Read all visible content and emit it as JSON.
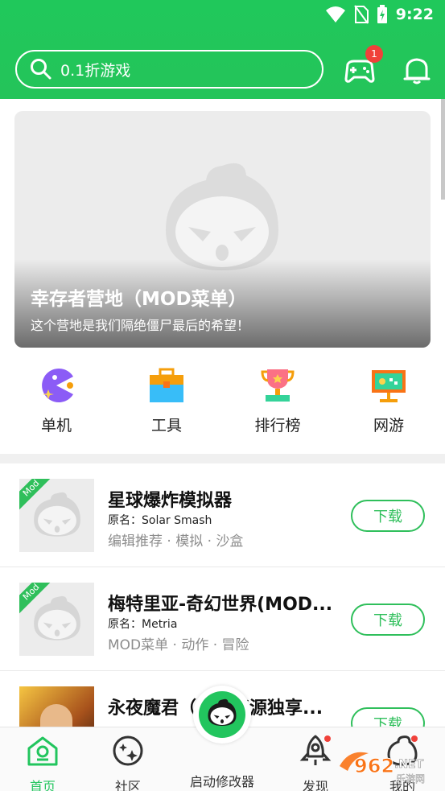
{
  "status_bar": {
    "time": "9:22"
  },
  "header": {
    "search_placeholder": "0.1折游戏",
    "gamepad_badge": "1"
  },
  "banner": {
    "title": "幸存者营地（MOD菜单）",
    "subtitle": "这个营地是我们隔绝僵尸最后的希望！"
  },
  "categories": [
    {
      "label": "单机",
      "icon": "pacman-icon"
    },
    {
      "label": "工具",
      "icon": "toolbox-icon"
    },
    {
      "label": "排行榜",
      "icon": "trophy-icon"
    },
    {
      "label": "网游",
      "icon": "monitor-game-icon"
    }
  ],
  "games": [
    {
      "name": "星球爆炸模拟器",
      "original": "原名：Solar Smash",
      "tags": "编辑推荐 · 模拟 · 沙盒",
      "mod": "Mod",
      "download": "下载"
    },
    {
      "name": "梅特里亚-奇幻世界(MOD...",
      "original": "原名：Metria",
      "tags": "MOD菜单 · 动作 · 冒险",
      "mod": "Mod",
      "download": "下载"
    },
    {
      "name": "永夜魔君（鬼服资源独享...",
      "original": "",
      "tags": "",
      "mod": "",
      "download": "下载"
    }
  ],
  "bottom_nav": [
    {
      "label": "首页",
      "icon": "home-icon",
      "active": true
    },
    {
      "label": "社区",
      "icon": "community-icon",
      "active": false
    },
    {
      "label": "启动修改器",
      "icon": "launcher-icon",
      "active": false
    },
    {
      "label": "发现",
      "icon": "rocket-icon",
      "active": false
    },
    {
      "label": "我的",
      "icon": "profile-icon",
      "active": false
    }
  ],
  "watermark": {
    "text": "962.NET",
    "sub": "乐游网"
  },
  "colors": {
    "primary": "#22c55e",
    "badge": "#f0413a",
    "tag_gray": "#8c8c8c"
  }
}
